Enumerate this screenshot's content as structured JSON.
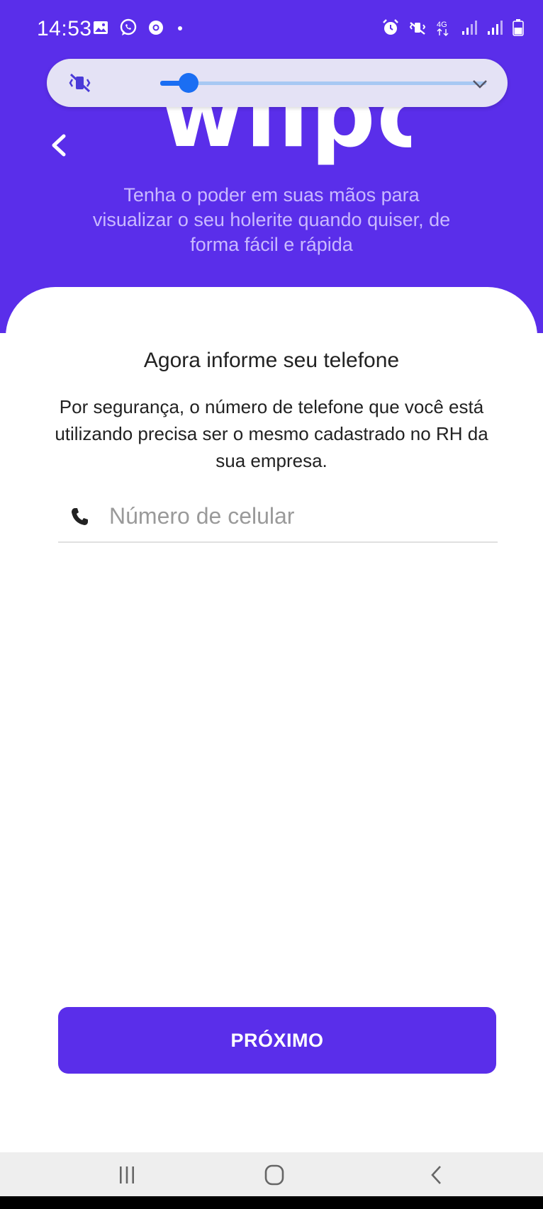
{
  "status_bar": {
    "time": "14:53",
    "network_label": "4G",
    "left_icons": [
      "gallery-icon",
      "whatsapp-icon",
      "chrome-icon",
      "dot-icon"
    ],
    "right_icons": [
      "alarm-icon",
      "vibrate-icon",
      "network-4g-icon",
      "signal-icon",
      "signal-icon",
      "battery-icon"
    ]
  },
  "volume_panel": {
    "mode_icon": "vibrate-mute-icon",
    "level": 0.05,
    "expand_icon": "chevron-down-icon"
  },
  "header": {
    "logo": "wiipo",
    "tagline": "Tenha o poder em suas mãos para visualizar o seu holerite quando quiser, de forma fácil e rápida",
    "back_icon": "chevron-left-icon"
  },
  "form": {
    "title": "Agora informe seu telefone",
    "description": "Por segurança, o número de telefone que você está utilizando precisa ser o mesmo cadastrado no RH da sua empresa.",
    "phone": {
      "icon": "phone-icon",
      "placeholder": "Número de celular",
      "value": ""
    },
    "next_label": "PRÓXIMO"
  },
  "nav_bar": {
    "items": [
      "recents-icon",
      "home-icon",
      "back-icon"
    ]
  },
  "colors": {
    "brand": "#5a2eea",
    "tagline": "#c9b9ff",
    "volume_accent": "#1a6ef3"
  }
}
